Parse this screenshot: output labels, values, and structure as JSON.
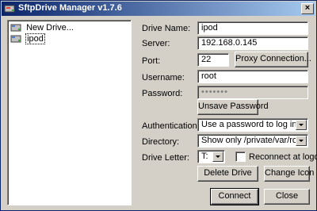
{
  "window": {
    "title": "SftpDrive Manager v1.7.6",
    "close_glyph": "×"
  },
  "tree": {
    "items": [
      {
        "label": "New Drive...",
        "icon": "drive-icon"
      },
      {
        "label": "ipod",
        "icon": "drive-icon",
        "selected": true
      }
    ]
  },
  "form": {
    "drive_name_label": "Drive Name:",
    "drive_name_value": "ipod",
    "server_label": "Server:",
    "server_value": "192.168.0.145",
    "port_label": "Port:",
    "port_value": "22",
    "proxy_button": "Proxy Connection...",
    "username_label": "Username:",
    "username_value": "root",
    "password_label": "Password:",
    "password_value": "•••••••",
    "unsave_password_button": "Unsave Password",
    "authentication_label": "Authentication:",
    "authentication_value": "Use a password to log in",
    "directory_label": "Directory:",
    "directory_value": "Show only /private/var/root/Medi",
    "drive_letter_label": "Drive Letter:",
    "drive_letter_value": "T:",
    "reconnect_label": "Reconnect at logon",
    "reconnect_checked": false,
    "delete_drive_button": "Delete Drive",
    "change_icon_button": "Change Icon",
    "connect_button": "Connect",
    "close_button": "Close"
  }
}
